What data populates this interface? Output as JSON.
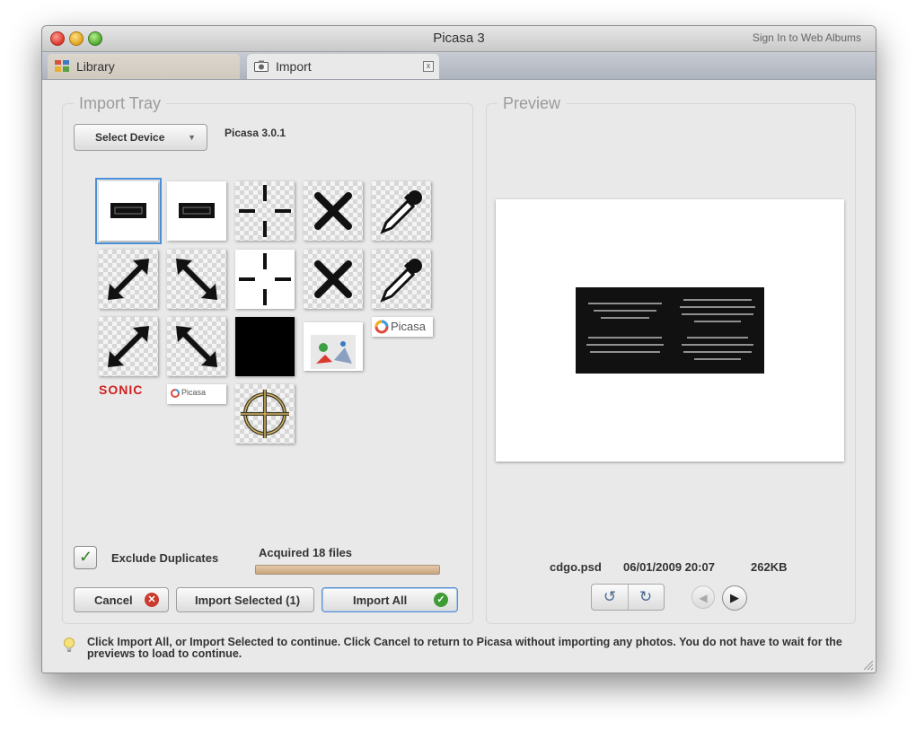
{
  "window": {
    "title": "Picasa 3",
    "signin_link": "Sign In to Web Albums"
  },
  "tabs": [
    {
      "label": "Library",
      "icon": "library-grid-icon"
    },
    {
      "label": "Import",
      "icon": "camera-icon",
      "close": "x"
    }
  ],
  "import_tray": {
    "title": "Import Tray",
    "select_device": "Select Device",
    "device_name": "Picasa 3.0.1",
    "sonic_label": "SONIC",
    "picasa_label": "Picasa",
    "exclude_duplicates": {
      "label": "Exclude Duplicates",
      "checked": true
    },
    "acquired_text": "Acquired 18 files",
    "progress_percent": 100,
    "buttons": {
      "cancel": "Cancel",
      "import_selected": "Import Selected (1)",
      "import_all": "Import All"
    }
  },
  "preview": {
    "title": "Preview",
    "filename": "cdgo.psd",
    "datetime": "06/01/2009 20:07",
    "filesize": "262KB"
  },
  "hint": "Click Import All, or Import Selected to continue. Click Cancel to return to Picasa without importing any photos. You do not have to wait for the previews to load to continue.",
  "colors": {
    "accent": "#4a90d6",
    "cancel_badge": "#c93a2f",
    "ok_badge": "#3f9c35",
    "progress": "#c8a57e"
  }
}
